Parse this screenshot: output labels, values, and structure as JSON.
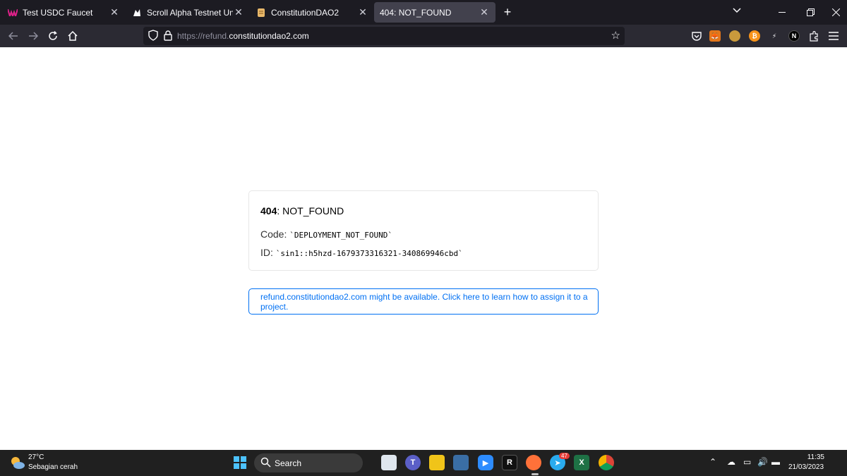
{
  "browser": {
    "tabs": [
      {
        "title": "Test USDC Faucet",
        "favicon": "wormhole-icon",
        "active": false
      },
      {
        "title": "Scroll Alpha Testnet Uniswap In",
        "favicon": "unicorn-icon",
        "active": false
      },
      {
        "title": "ConstitutionDAO2",
        "favicon": "scroll-icon",
        "active": false
      },
      {
        "title": "404: NOT_FOUND",
        "favicon": "",
        "active": true
      }
    ],
    "new_tab_label": "+",
    "url_protocol": "https://refund.",
    "url_domain": "constitutiondao2.com"
  },
  "page": {
    "error_code": "404",
    "error_name": ": NOT_FOUND",
    "code_label": "Code:",
    "code_value": "`DEPLOYMENT_NOT_FOUND`",
    "id_label": "ID:",
    "id_value": "`sin1::h5hzd-1679373316321-340869946cbd`",
    "hint": "refund.constitutiondao2.com might be available. Click here to learn how to assign it to a project."
  },
  "taskbar": {
    "temperature": "27°C",
    "weather": "Sebagian cerah",
    "search_label": "Search",
    "telegram_badge": "47",
    "time": "11:35",
    "date": "21/03/2023"
  },
  "colors": {
    "accent": "#0070f3",
    "tabbar_bg": "#1c1b22",
    "toolbar_bg": "#2b2a33",
    "taskbar_bg": "#202020"
  }
}
